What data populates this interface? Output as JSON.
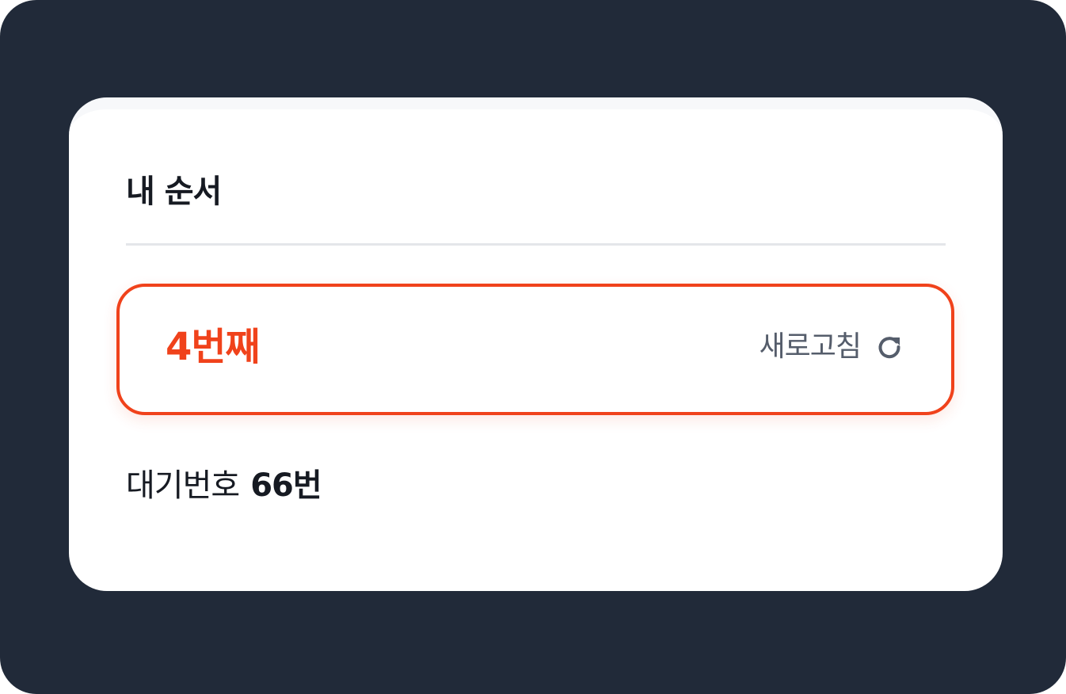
{
  "card": {
    "title": "내 순서"
  },
  "queue": {
    "position": "4번째",
    "refresh_label": "새로고침",
    "refresh_icon": "refresh-icon"
  },
  "waiting": {
    "label": "대기번호",
    "number": "66번"
  },
  "colors": {
    "background": "#212a39",
    "accent": "#f0421b",
    "text_primary": "#161a22",
    "text_secondary": "#555d6b",
    "divider": "#e4e6ea"
  }
}
